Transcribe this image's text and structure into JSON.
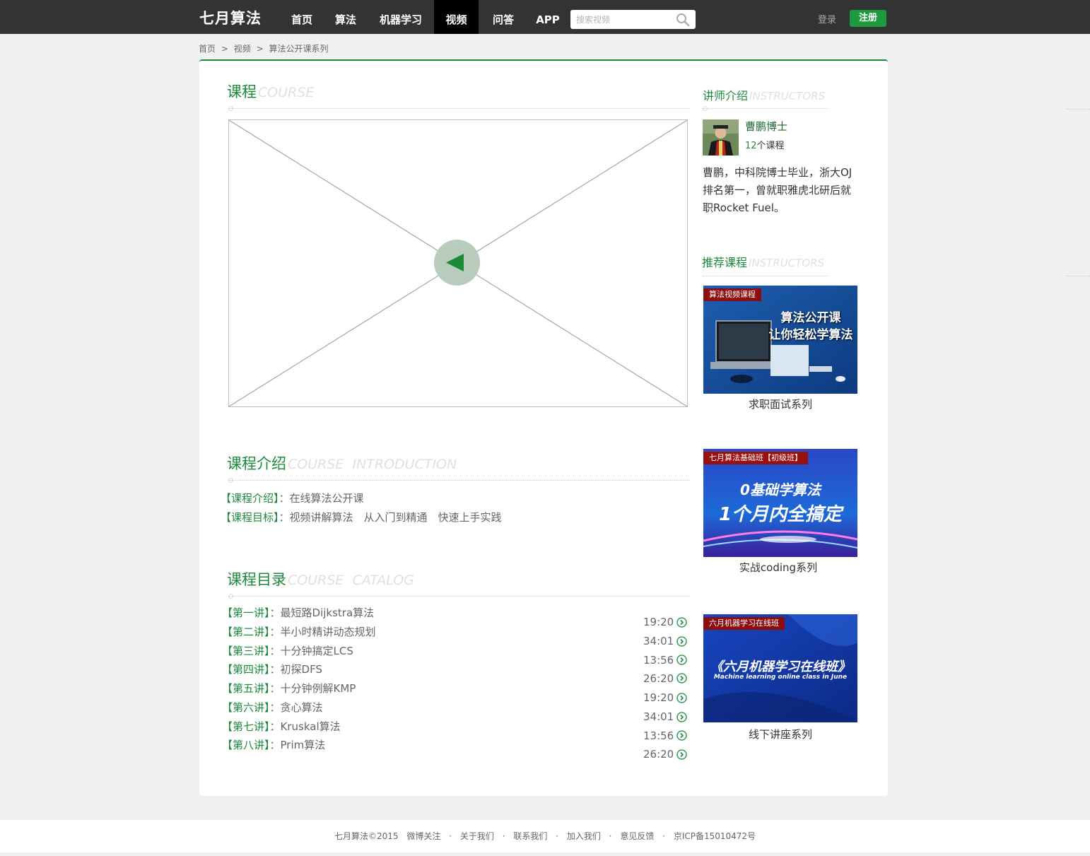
{
  "brand": {
    "logo": "七月算法"
  },
  "nav": {
    "items": [
      "首页",
      "算法",
      "机器学习",
      "视频",
      "问答",
      "APP"
    ],
    "active": "视频"
  },
  "search": {
    "placeholder": "搜索视频",
    "icon": "search-icon"
  },
  "auth": {
    "login": "登录",
    "register": "注册"
  },
  "colors": {
    "brand_green": "#1d8a3a",
    "topbar": "#333333",
    "nav_active": "#000000",
    "tag_red": "#8b0d0d"
  },
  "breadcrumb": {
    "items": [
      "首页",
      "视频",
      "算法公开课系列"
    ],
    "separator": ">"
  },
  "course": {
    "title": "课程",
    "title_en": "COURSE",
    "play_icon": "play-icon"
  },
  "intro": {
    "title": "课程介绍",
    "title_en": "COURSE  INTRODUCTION",
    "lines": [
      {
        "label": "【课程介绍】",
        "text": "：在线算法公开课"
      },
      {
        "label": "【课程目标】",
        "text": "：视频讲解算法　从入门到精通　快速上手实践"
      }
    ]
  },
  "catalog": {
    "title": "课程目录",
    "title_en": "COURSE  CATALOG",
    "lessons": [
      {
        "label": "【第一讲】",
        "title": "：最短路Dijkstra算法",
        "duration": "19:20"
      },
      {
        "label": "【第二讲】",
        "title": "：半小时精讲动态规划",
        "duration": "34:01"
      },
      {
        "label": "【第三讲】",
        "title": "：十分钟搞定LCS",
        "duration": "13:56"
      },
      {
        "label": "【第四讲】",
        "title": "：初探DFS",
        "duration": "26:20"
      },
      {
        "label": "【第五讲】",
        "title": "：十分钟例解KMP",
        "duration": "19:20"
      },
      {
        "label": "【第六讲】",
        "title": "：贪心算法",
        "duration": "34:01"
      },
      {
        "label": "【第七讲】",
        "title": "：Kruskal算法",
        "duration": "13:56"
      },
      {
        "label": "【第八讲】",
        "title": "：Prim算法",
        "duration": "26:20"
      }
    ]
  },
  "instructor": {
    "title": "讲师介绍",
    "title_en": "INSTRUCTORS",
    "name": "曹鹏博士",
    "course_count": "12",
    "course_unit": "个课程",
    "bio": "曹鹏，中科院博士毕业，浙大OJ排名第一，曾就职雅虎北研后就职Rocket Fuel。"
  },
  "recommend": {
    "title": "推荐课程",
    "title_en": "INSTRUCTORS",
    "cards": [
      {
        "tag": "算法视频课程",
        "headline1": "算法公开课",
        "headline2": "让你轻松学算法",
        "caption": "求职面试系列"
      },
      {
        "tag": "七月算法基础班【初级班】",
        "headline1": "0基础学算法",
        "headline2": "1个月内全搞定",
        "caption": "实战coding系列"
      },
      {
        "tag": "六月机器学习在线班",
        "headline1": "《六月机器学习在线班》",
        "headline2": "Machine learning online class in June",
        "caption": "线下讲座系列"
      }
    ]
  },
  "footer": {
    "items": [
      "七月算法©2015",
      "微博关注",
      "·",
      "关于我们",
      "·",
      "联系我们",
      "·",
      "加入我们",
      "·",
      "意见反馈",
      "·",
      "京ICP备15010472号"
    ]
  }
}
